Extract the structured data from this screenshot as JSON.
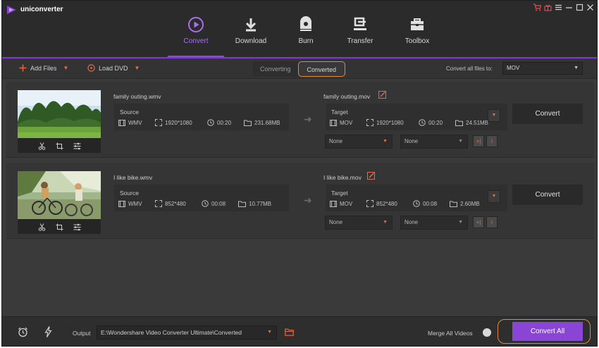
{
  "app": {
    "title": "uniconverter"
  },
  "colors": {
    "accent_purple": "#8a45d6",
    "highlight_orange": "#e48a3c",
    "caret_red": "#e46a48"
  },
  "nav": {
    "tabs": [
      {
        "label": "Convert",
        "icon": "convert-icon",
        "active": true
      },
      {
        "label": "Download",
        "icon": "download-icon"
      },
      {
        "label": "Burn",
        "icon": "burn-icon"
      },
      {
        "label": "Transfer",
        "icon": "transfer-icon"
      },
      {
        "label": "Toolbox",
        "icon": "toolbox-icon"
      }
    ]
  },
  "toolbar": {
    "add_files": "Add Files",
    "load_dvd": "Load DVD",
    "tabs": {
      "converting": "Converting",
      "converted": "Converted"
    },
    "convert_all_label": "Convert all files to:",
    "format_value": "MOV"
  },
  "files": [
    {
      "source_name": "family outing.wmv",
      "target_name": "family outing.mov",
      "source": {
        "title": "Source",
        "format": "WMV",
        "resolution": "1920*1080",
        "duration": "00:20",
        "size": "231.68MB"
      },
      "target": {
        "title": "Target",
        "format": "MOV",
        "resolution": "1920*1080",
        "duration": "00:20",
        "size": "24.51MB"
      },
      "subtitle": "None",
      "audio": "None",
      "convert_label": "Convert"
    },
    {
      "source_name": "I like bike.wmv",
      "target_name": "I like bike.mov",
      "source": {
        "title": "Source",
        "format": "WMV",
        "resolution": "852*480",
        "duration": "00:08",
        "size": "10.77MB"
      },
      "target": {
        "title": "Target",
        "format": "MOV",
        "resolution": "852*480",
        "duration": "00:08",
        "size": "2.60MB"
      },
      "subtitle": "None",
      "audio": "None",
      "convert_label": "Convert"
    }
  ],
  "bottom": {
    "output_label": "Output",
    "output_path": "E:\\Wondershare Video Converter Ultimate\\Converted",
    "merge_label": "Merge All Videos",
    "convert_all": "Convert All"
  }
}
